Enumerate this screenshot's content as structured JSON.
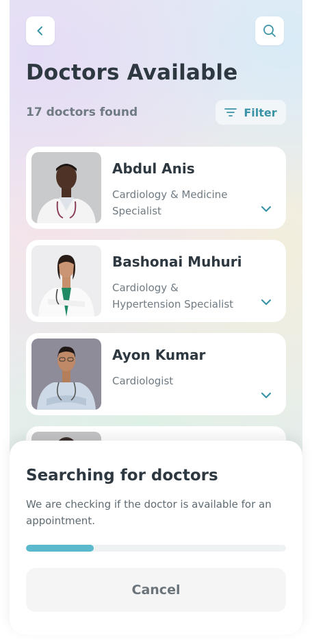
{
  "header": {
    "back_icon": "chevron-left-icon",
    "search_icon": "search-icon",
    "title": "Doctors Available",
    "results_count": "17 doctors found",
    "filter_label": "Filter",
    "filter_icon": "filter-lines-icon"
  },
  "doctors": [
    {
      "name": "Abdul Anis",
      "specialty": "Cardiology & Medicine Specialist"
    },
    {
      "name": "Bashonai Muhuri",
      "specialty": "Cardiology & Hypertension Specialist"
    },
    {
      "name": "Ayon Kumar",
      "specialty": "Cardiologist"
    }
  ],
  "search_sheet": {
    "title": "Searching for doctors",
    "description": "We are checking if the doctor is available for an appointment.",
    "progress": 0.26,
    "cancel_label": "Cancel"
  },
  "colors": {
    "accent": "#3a93a6",
    "progress_fill": "#5ab9cc",
    "title_text": "#2e3840"
  }
}
